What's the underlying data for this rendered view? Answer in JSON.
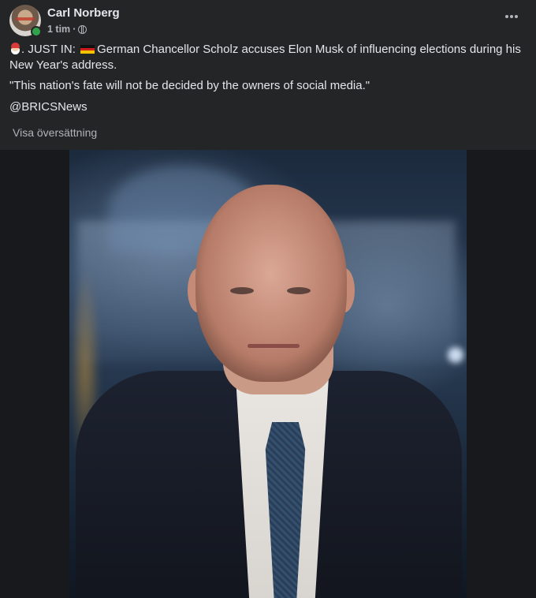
{
  "post": {
    "author": "Carl Norberg",
    "time": "1 tim",
    "separator": "·",
    "privacy_icon": "globe-icon",
    "more_icon": "more-horizontal-icon",
    "lines": {
      "prefix": ".  JUST IN: ",
      "headline": "German Chancellor Scholz accuses Elon Musk of influencing elections during his New Year's address.",
      "quote": "\"This nation's fate will not be decided by the owners of social media.\"",
      "handle": "@BRICSNews"
    },
    "translate_label": "Visa översättning"
  },
  "colors": {
    "background": "#242526",
    "text_primary": "#e4e6eb",
    "text_secondary": "#b0b3b8",
    "online": "#31a24c",
    "media_background": "#18191c"
  }
}
